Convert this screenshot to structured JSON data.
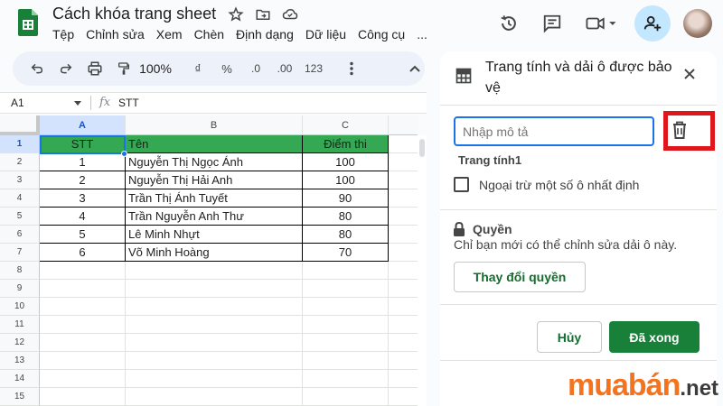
{
  "app": {
    "title": "Cách khóa trang sheet"
  },
  "menu": [
    "Tệp",
    "Chỉnh sửa",
    "Xem",
    "Chèn",
    "Định dạng",
    "Dữ liệu",
    "Công cụ",
    "..."
  ],
  "toolbar": {
    "zoom": "100%",
    "currency": "₫",
    "percent": "%",
    "dec_decrease": ".0",
    "dec_increase": ".00",
    "number_format": "123"
  },
  "formula_bar": {
    "name_box": "A1",
    "fx": "fx",
    "value": "STT"
  },
  "grid": {
    "columns": [
      "A",
      "B",
      "C"
    ],
    "row_numbers": [
      "1",
      "2",
      "3",
      "4",
      "5",
      "6",
      "7",
      "8",
      "9",
      "10",
      "11",
      "12",
      "13",
      "14",
      "15"
    ],
    "header": [
      "STT",
      "Tên",
      "Điểm thi"
    ],
    "rows": [
      [
        "1",
        "Nguyễn Thị Ngọc Ánh",
        "100"
      ],
      [
        "2",
        "Nguyễn Thị Hải Anh",
        "100"
      ],
      [
        "3",
        "Trần Thị Ánh Tuyết",
        "90"
      ],
      [
        "4",
        "Trần Nguyễn Anh Thư",
        "80"
      ],
      [
        "5",
        "Lê Minh Nhựt",
        "80"
      ],
      [
        "6",
        "Võ Minh Hoàng",
        "70"
      ]
    ]
  },
  "panel": {
    "title": "Trang tính và dải ô được bảo vệ",
    "close": "×",
    "description_placeholder": "Nhập mô tả",
    "range_label": "Trang tính1",
    "except_label": "Ngoại trừ một số ô nhất định",
    "permissions_title": "Quyền",
    "permissions_desc": "Chỉ bạn mới có thể chỉnh sửa dải ô này.",
    "change_button": "Thay đổi quyền",
    "cancel_button": "Hủy",
    "done_button": "Đã xong"
  },
  "watermark": {
    "main": "muabán",
    "suffix": ".net"
  },
  "colors": {
    "header_fill": "#34a853",
    "primary_green": "#188038",
    "highlight_red": "#e0161d",
    "brand_orange": "#f4731f"
  },
  "icons": [
    "sheets-logo-icon",
    "star-icon",
    "move-folder-icon",
    "cloud-status-icon",
    "history-icon",
    "comment-icon",
    "meet-icon",
    "share-icon",
    "undo-icon",
    "redo-icon",
    "print-icon",
    "paint-format-icon",
    "more-vert-icon",
    "collapse-icon",
    "table-icon",
    "close-icon",
    "trash-icon",
    "lock-icon"
  ]
}
